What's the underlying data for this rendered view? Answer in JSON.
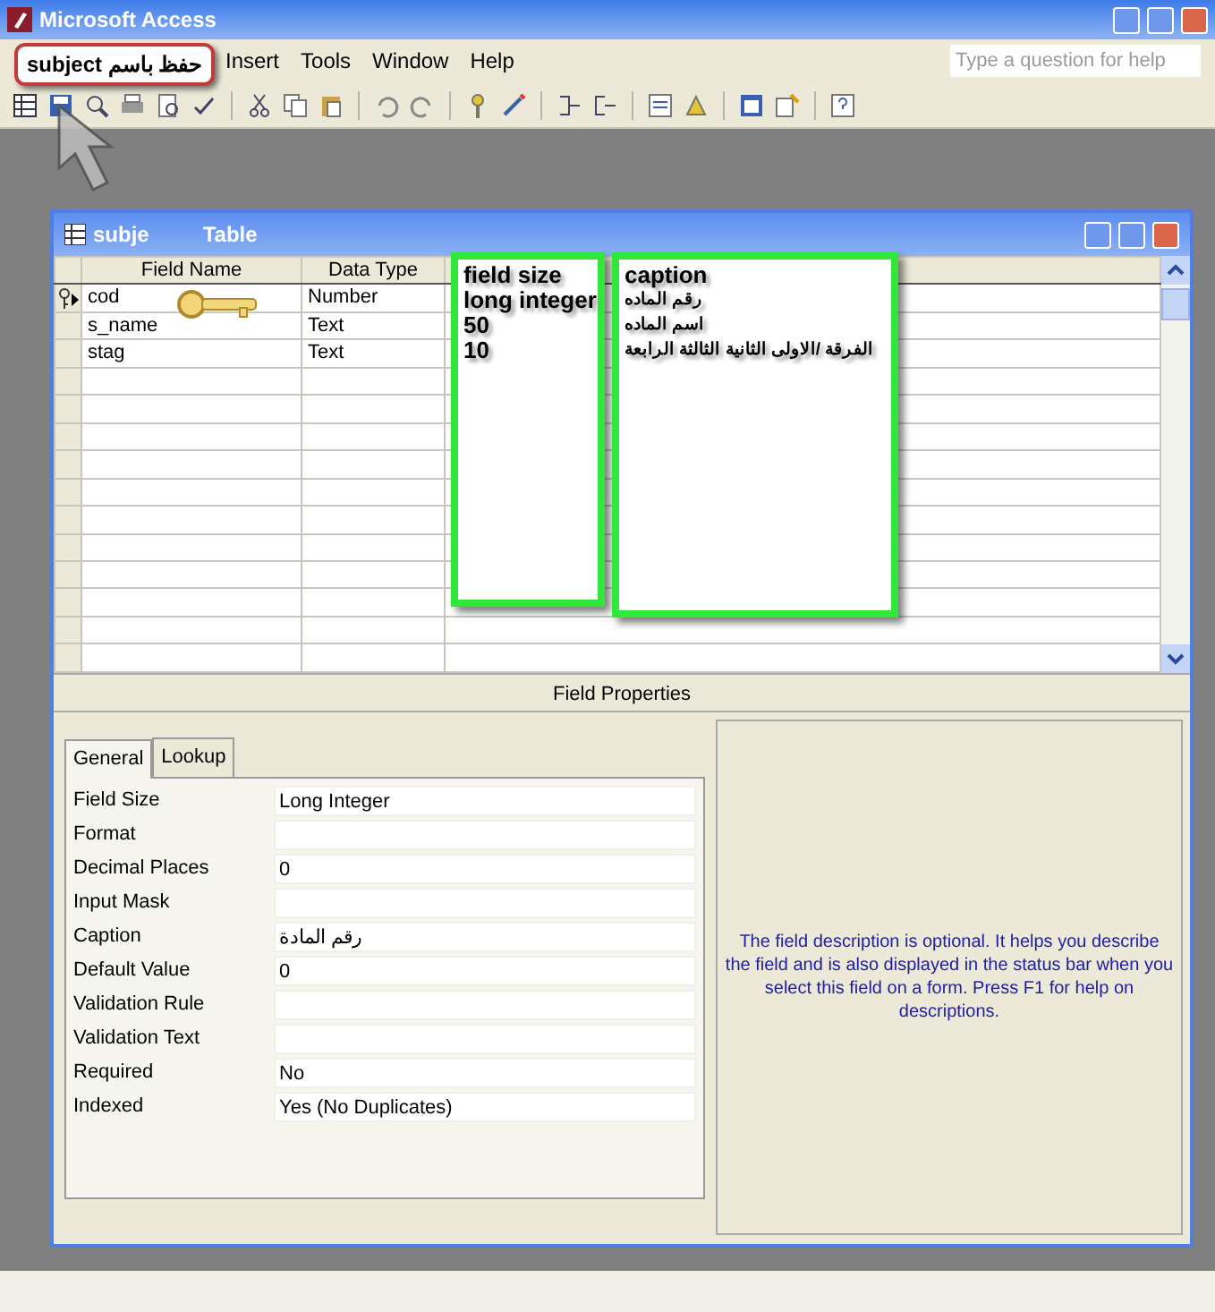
{
  "window": {
    "title": "Microsoft Access"
  },
  "menu": [
    "Insert",
    "Tools",
    "Window",
    "Help"
  ],
  "callout": {
    "text": "حفظ باسم subject"
  },
  "help_box": {
    "placeholder": "Type a question for help"
  },
  "table_window": {
    "title_parts": [
      "subje",
      "Table"
    ]
  },
  "grid": {
    "columns": [
      "Field Name",
      "Data Type"
    ],
    "rows": [
      {
        "field_name": "cod",
        "data_type": "Number",
        "primary_key": true,
        "current": true
      },
      {
        "field_name": "s_name",
        "data_type": "Text",
        "primary_key": false,
        "current": false
      },
      {
        "field_name": "stag",
        "data_type": "Text",
        "primary_key": false,
        "current": false
      }
    ]
  },
  "annotations": [
    {
      "lines": [
        "field size",
        "long integer",
        "50",
        "10"
      ]
    },
    {
      "lines": [
        "caption",
        "رقم الماده",
        "اسم الماده",
        "الفرقة /الاولى الثانية الثالثة الرابعة"
      ]
    }
  ],
  "field_properties": {
    "title": "Field Properties",
    "tabs": [
      {
        "label": "General",
        "selected": true
      },
      {
        "label": "Lookup",
        "selected": false
      }
    ],
    "properties": [
      {
        "label": "Field Size",
        "value": "Long Integer"
      },
      {
        "label": "Format"
      },
      {
        "label": "Decimal Places",
        "value": "0"
      },
      {
        "label": "Input Mask"
      },
      {
        "label": "Caption",
        "value": "رقم المادة"
      },
      {
        "label": "Default Value",
        "value": "0"
      },
      {
        "label": "Validation Rule"
      },
      {
        "label": "Validation Text"
      },
      {
        "label": "Required",
        "value": "No"
      },
      {
        "label": "Indexed",
        "value": "Yes (No Duplicates)"
      }
    ],
    "help_text": "The field description is optional.  It helps you describe the field and is also displayed in the status bar when you select this field on a form.  Press F1 for help on descriptions."
  }
}
